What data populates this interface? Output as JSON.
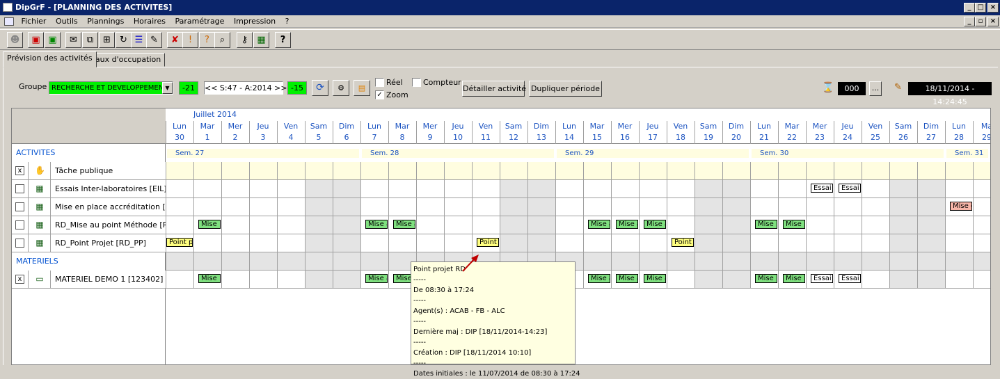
{
  "window": {
    "title": "DipGrF - [PLANNING DES ACTIVITES]"
  },
  "menu": [
    "Fichier",
    "Outils",
    "Plannings",
    "Horaires",
    "Paramétrage",
    "Impression",
    "?"
  ],
  "tabs": [
    "Prévision des activités",
    "Taux d'occupation"
  ],
  "controls": {
    "groupe_label": "Groupe",
    "groupe_value": "RECHERCHE ET DEVELOPPEMENT",
    "prev_value": "-21",
    "period": "<< S:47 - A:2014 >>",
    "next_value": "-15",
    "reel_label": "Réel",
    "compteur_label": "Compteur",
    "zoom_label": "Zoom",
    "zoom_checked": "✓",
    "detail_btn": "Détailler activité",
    "dup_btn": "Dupliquer période",
    "counter": "000",
    "ellipsis": "...",
    "datetime": "18/11/2014 - 14:24:45"
  },
  "calendar": {
    "month": "Juillet 2014",
    "days": [
      [
        "Lun",
        "30"
      ],
      [
        "Mar",
        "1"
      ],
      [
        "Mer",
        "2"
      ],
      [
        "Jeu",
        "3"
      ],
      [
        "Ven",
        "4"
      ],
      [
        "Sam",
        "5"
      ],
      [
        "Dim",
        "6"
      ],
      [
        "Lun",
        "7"
      ],
      [
        "Mar",
        "8"
      ],
      [
        "Mer",
        "9"
      ],
      [
        "Jeu",
        "10"
      ],
      [
        "Ven",
        "11"
      ],
      [
        "Sam",
        "12"
      ],
      [
        "Dim",
        "13"
      ],
      [
        "Lun",
        "14"
      ],
      [
        "Mar",
        "15"
      ],
      [
        "Mer",
        "16"
      ],
      [
        "Jeu",
        "17"
      ],
      [
        "Ven",
        "18"
      ],
      [
        "Sam",
        "19"
      ],
      [
        "Dim",
        "20"
      ],
      [
        "Lun",
        "21"
      ],
      [
        "Mar",
        "22"
      ],
      [
        "Mer",
        "23"
      ],
      [
        "Jeu",
        "24"
      ],
      [
        "Ven",
        "25"
      ],
      [
        "Sam",
        "26"
      ],
      [
        "Dim",
        "27"
      ],
      [
        "Lun",
        "28"
      ],
      [
        "Ma",
        "29"
      ]
    ],
    "weeks": [
      "Sem. 27",
      "Sem. 28",
      "Sem. 29",
      "Sem. 30",
      "Sem. 31"
    ]
  },
  "sections": {
    "activites": "ACTIVITES",
    "materiels": "MATERIELS"
  },
  "rows": [
    {
      "name": "Tâche publique",
      "checked": "x"
    },
    {
      "name": "Essais Inter-laboratoires [EIL]",
      "checked": ""
    },
    {
      "name": "Mise en place accréditation [...",
      "checked": ""
    },
    {
      "name": "RD_Mise au point Méthode [R...",
      "checked": ""
    },
    {
      "name": "RD_Point Projet [RD_PP]",
      "checked": ""
    },
    {
      "name": "MATERIEL DEMO 1 [123402]",
      "checked": "x"
    }
  ],
  "bars": {
    "mise": "Mise",
    "mise_au": "Mise au",
    "essai": "Essai",
    "mise_en": "Mise en",
    "point_p": "Point p"
  },
  "tooltip": [
    "Point projet RD",
    "-----",
    "De 08:30 à 17:24",
    "-----",
    "Agent(s) : ACAB - FB - ALC",
    "-----",
    "Dernière maj : DIP [18/11/2014-14:23]",
    "-----",
    "Création : DIP [18/11/2014 10:10]",
    "-----",
    "Dates initiales : le 11/07/2014 de 08:30 à 17:24"
  ],
  "colors": {
    "title_bg": "#0a246a",
    "green": "#00f000",
    "bar_green": "#7fe07f",
    "bar_yellow": "#ffff80",
    "bar_pink": "#f7b5a8",
    "weekend": "#e4e4e4",
    "tooltip_bg": "#ffffe1"
  }
}
